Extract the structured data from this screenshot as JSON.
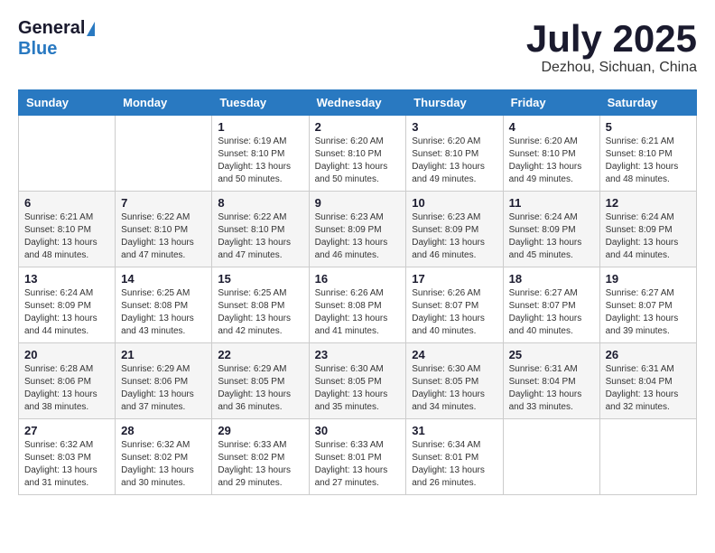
{
  "header": {
    "logo_general": "General",
    "logo_blue": "Blue",
    "title": "July 2025",
    "location": "Dezhou, Sichuan, China"
  },
  "weekdays": [
    "Sunday",
    "Monday",
    "Tuesday",
    "Wednesday",
    "Thursday",
    "Friday",
    "Saturday"
  ],
  "weeks": [
    [
      {
        "day": "",
        "info": ""
      },
      {
        "day": "",
        "info": ""
      },
      {
        "day": "1",
        "info": "Sunrise: 6:19 AM\nSunset: 8:10 PM\nDaylight: 13 hours and 50 minutes."
      },
      {
        "day": "2",
        "info": "Sunrise: 6:20 AM\nSunset: 8:10 PM\nDaylight: 13 hours and 50 minutes."
      },
      {
        "day": "3",
        "info": "Sunrise: 6:20 AM\nSunset: 8:10 PM\nDaylight: 13 hours and 49 minutes."
      },
      {
        "day": "4",
        "info": "Sunrise: 6:20 AM\nSunset: 8:10 PM\nDaylight: 13 hours and 49 minutes."
      },
      {
        "day": "5",
        "info": "Sunrise: 6:21 AM\nSunset: 8:10 PM\nDaylight: 13 hours and 48 minutes."
      }
    ],
    [
      {
        "day": "6",
        "info": "Sunrise: 6:21 AM\nSunset: 8:10 PM\nDaylight: 13 hours and 48 minutes."
      },
      {
        "day": "7",
        "info": "Sunrise: 6:22 AM\nSunset: 8:10 PM\nDaylight: 13 hours and 47 minutes."
      },
      {
        "day": "8",
        "info": "Sunrise: 6:22 AM\nSunset: 8:10 PM\nDaylight: 13 hours and 47 minutes."
      },
      {
        "day": "9",
        "info": "Sunrise: 6:23 AM\nSunset: 8:09 PM\nDaylight: 13 hours and 46 minutes."
      },
      {
        "day": "10",
        "info": "Sunrise: 6:23 AM\nSunset: 8:09 PM\nDaylight: 13 hours and 46 minutes."
      },
      {
        "day": "11",
        "info": "Sunrise: 6:24 AM\nSunset: 8:09 PM\nDaylight: 13 hours and 45 minutes."
      },
      {
        "day": "12",
        "info": "Sunrise: 6:24 AM\nSunset: 8:09 PM\nDaylight: 13 hours and 44 minutes."
      }
    ],
    [
      {
        "day": "13",
        "info": "Sunrise: 6:24 AM\nSunset: 8:09 PM\nDaylight: 13 hours and 44 minutes."
      },
      {
        "day": "14",
        "info": "Sunrise: 6:25 AM\nSunset: 8:08 PM\nDaylight: 13 hours and 43 minutes."
      },
      {
        "day": "15",
        "info": "Sunrise: 6:25 AM\nSunset: 8:08 PM\nDaylight: 13 hours and 42 minutes."
      },
      {
        "day": "16",
        "info": "Sunrise: 6:26 AM\nSunset: 8:08 PM\nDaylight: 13 hours and 41 minutes."
      },
      {
        "day": "17",
        "info": "Sunrise: 6:26 AM\nSunset: 8:07 PM\nDaylight: 13 hours and 40 minutes."
      },
      {
        "day": "18",
        "info": "Sunrise: 6:27 AM\nSunset: 8:07 PM\nDaylight: 13 hours and 40 minutes."
      },
      {
        "day": "19",
        "info": "Sunrise: 6:27 AM\nSunset: 8:07 PM\nDaylight: 13 hours and 39 minutes."
      }
    ],
    [
      {
        "day": "20",
        "info": "Sunrise: 6:28 AM\nSunset: 8:06 PM\nDaylight: 13 hours and 38 minutes."
      },
      {
        "day": "21",
        "info": "Sunrise: 6:29 AM\nSunset: 8:06 PM\nDaylight: 13 hours and 37 minutes."
      },
      {
        "day": "22",
        "info": "Sunrise: 6:29 AM\nSunset: 8:05 PM\nDaylight: 13 hours and 36 minutes."
      },
      {
        "day": "23",
        "info": "Sunrise: 6:30 AM\nSunset: 8:05 PM\nDaylight: 13 hours and 35 minutes."
      },
      {
        "day": "24",
        "info": "Sunrise: 6:30 AM\nSunset: 8:05 PM\nDaylight: 13 hours and 34 minutes."
      },
      {
        "day": "25",
        "info": "Sunrise: 6:31 AM\nSunset: 8:04 PM\nDaylight: 13 hours and 33 minutes."
      },
      {
        "day": "26",
        "info": "Sunrise: 6:31 AM\nSunset: 8:04 PM\nDaylight: 13 hours and 32 minutes."
      }
    ],
    [
      {
        "day": "27",
        "info": "Sunrise: 6:32 AM\nSunset: 8:03 PM\nDaylight: 13 hours and 31 minutes."
      },
      {
        "day": "28",
        "info": "Sunrise: 6:32 AM\nSunset: 8:02 PM\nDaylight: 13 hours and 30 minutes."
      },
      {
        "day": "29",
        "info": "Sunrise: 6:33 AM\nSunset: 8:02 PM\nDaylight: 13 hours and 29 minutes."
      },
      {
        "day": "30",
        "info": "Sunrise: 6:33 AM\nSunset: 8:01 PM\nDaylight: 13 hours and 27 minutes."
      },
      {
        "day": "31",
        "info": "Sunrise: 6:34 AM\nSunset: 8:01 PM\nDaylight: 13 hours and 26 minutes."
      },
      {
        "day": "",
        "info": ""
      },
      {
        "day": "",
        "info": ""
      }
    ]
  ]
}
